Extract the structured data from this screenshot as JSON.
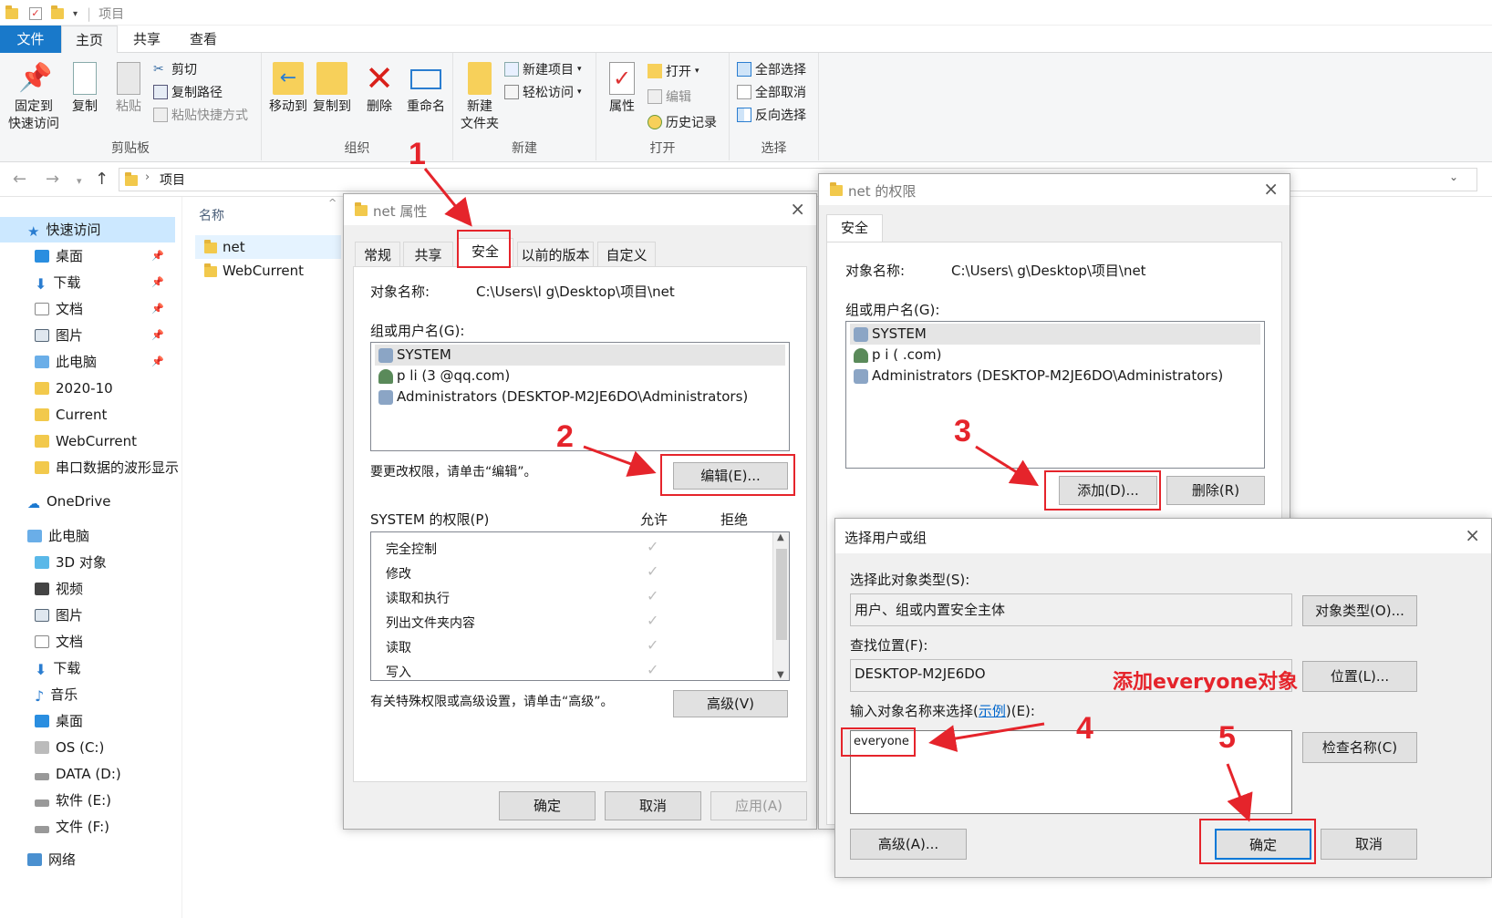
{
  "titlebar": {
    "text": "项目"
  },
  "ribbon_tabs": {
    "file": "文件",
    "home": "主页",
    "share": "共享",
    "view": "查看"
  },
  "ribbon": {
    "clipboard": {
      "label": "剪贴板",
      "pin_line1": "固定到",
      "pin_line2": "快速访问",
      "copy": "复制",
      "paste": "粘贴",
      "cut": "剪切",
      "copy_path": "复制路径",
      "paste_shortcut": "粘贴快捷方式"
    },
    "organize": {
      "label": "组织",
      "move_to": "移动到",
      "copy_to": "复制到",
      "delete": "删除",
      "rename": "重命名"
    },
    "new": {
      "label": "新建",
      "new_folder_line1": "新建",
      "new_folder_line2": "文件夹",
      "new_item": "新建项目",
      "easy_access": "轻松访问"
    },
    "open": {
      "label": "打开",
      "properties": "属性",
      "open": "打开",
      "edit": "编辑",
      "history": "历史记录"
    },
    "select": {
      "label": "选择",
      "select_all": "全部选择",
      "select_none": "全部取消",
      "invert": "反向选择"
    }
  },
  "address": {
    "path": "项目"
  },
  "sidebar": {
    "quick_access": "快速访问",
    "items": [
      "桌面",
      "下载",
      "文档",
      "图片",
      "此电脑",
      "2020-10",
      "Current",
      "WebCurrent",
      "串口数据的波形显示"
    ],
    "onedrive": "OneDrive",
    "this_pc": "此电脑",
    "pc_items": [
      "3D 对象",
      "视频",
      "图片",
      "文档",
      "下载",
      "音乐",
      "桌面",
      "OS (C:)",
      "DATA (D:)",
      "软件 (E:)",
      "文件 (F:)"
    ],
    "network": "网络"
  },
  "filelist": {
    "column_name": "名称",
    "files": [
      "net",
      "WebCurrent"
    ]
  },
  "props_dialog": {
    "title": "net 属性",
    "tabs": [
      "常规",
      "共享",
      "安全",
      "以前的版本",
      "自定义"
    ],
    "object_label": "对象名称:",
    "object_value": "C:\\Users\\l        g\\Desktop\\项目\\net",
    "group_label": "组或用户名(G):",
    "users": [
      "SYSTEM",
      "p        li (3             @qq.com)",
      "Administrators (DESKTOP-M2JE6DO\\Administrators)"
    ],
    "change_hint": "要更改权限，请单击“编辑”。",
    "edit_button": "编辑(E)...",
    "perm_label": "SYSTEM 的权限(P)",
    "allow": "允许",
    "deny": "拒绝",
    "perms": [
      "完全控制",
      "修改",
      "读取和执行",
      "列出文件夹内容",
      "读取",
      "写入"
    ],
    "advanced_hint": "有关特殊权限或高级设置，请单击“高级”。",
    "advanced_button": "高级(V)",
    "ok": "确定",
    "cancel": "取消",
    "apply": "应用(A)"
  },
  "perm_dialog": {
    "title": "net 的权限",
    "tab": "安全",
    "object_label": "对象名称:",
    "object_value": "C:\\Users\\        g\\Desktop\\项目\\net",
    "group_label": "组或用户名(G):",
    "users": [
      "SYSTEM",
      "p        i (             .com)",
      "Administrators (DESKTOP-M2JE6DO\\Administrators)"
    ],
    "add_button": "添加(D)...",
    "remove_button": "删除(R)"
  },
  "select_dialog": {
    "title": "选择用户或组",
    "type_label": "选择此对象类型(S):",
    "type_value": "用户、组或内置安全主体",
    "type_button": "对象类型(O)...",
    "location_label": "查找位置(F):",
    "location_value": "DESKTOP-M2JE6DO",
    "location_button": "位置(L)...",
    "enter_label_pre": "输入对象名称来选择(",
    "enter_label_link": "示例",
    "enter_label_post": ")(E):",
    "entered_value": "everyone",
    "check_button": "检查名称(C)",
    "advanced_button": "高级(A)...",
    "ok": "确定",
    "cancel": "取消"
  },
  "annotations": {
    "steps": [
      "1",
      "2",
      "3",
      "4",
      "5"
    ],
    "note": "添加everyone对象",
    "color": "#e5242b"
  }
}
